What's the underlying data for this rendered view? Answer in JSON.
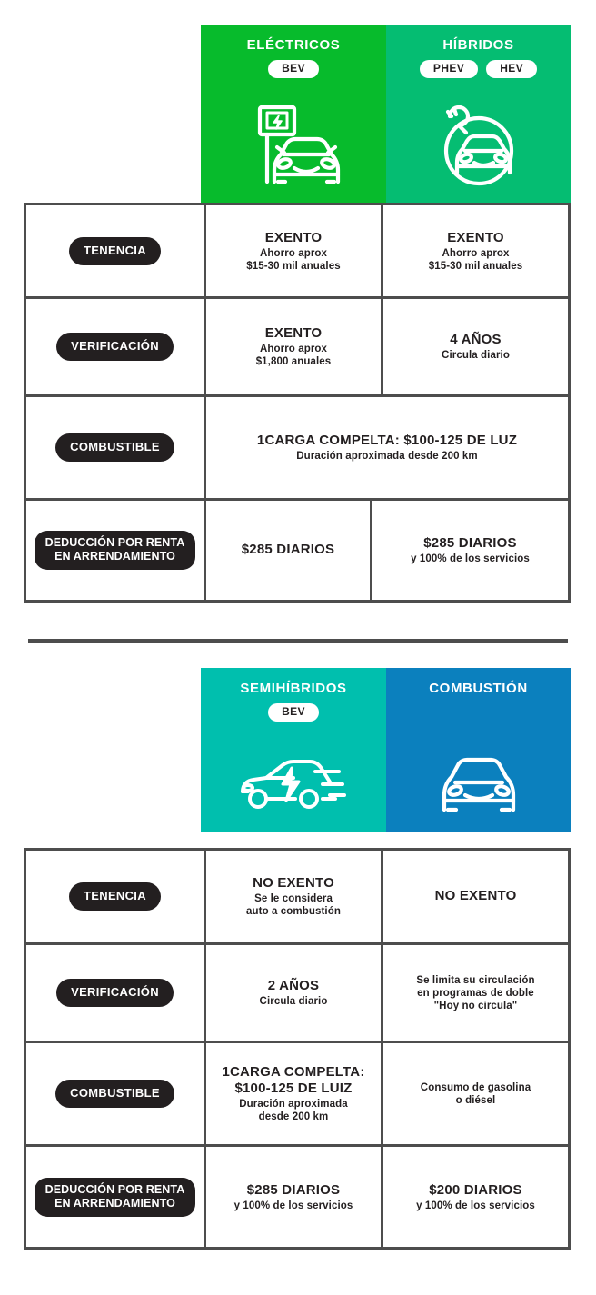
{
  "tables": [
    {
      "id": "electric-hybrid",
      "headers": [
        {
          "title": "ELÉCTRICOS",
          "badges": [
            "BEV"
          ],
          "color": "#07BB2C",
          "icon": "ev-charging-station-car-icon"
        },
        {
          "title": "HÍBRIDOS",
          "badges": [
            "PHEV",
            "HEV"
          ],
          "color": "#05BD72",
          "icon": "plug-in-hybrid-car-circle-icon"
        }
      ],
      "rows": [
        {
          "label": "TENENCIA",
          "cells": [
            {
              "main": "EXENTO",
              "sub": "Ahorro aprox\n$15-30 mil anuales"
            },
            {
              "main": "EXENTO",
              "sub": "Ahorro aprox\n$15-30 mil anuales"
            }
          ]
        },
        {
          "label": "VERIFICACIÓN",
          "cells": [
            {
              "main": "EXENTO",
              "sub": "Ahorro aprox\n$1,800 anuales"
            },
            {
              "main": "4 AÑOS",
              "sub": "Circula diario"
            }
          ]
        },
        {
          "label": "COMBUSTIBLE",
          "merged": true,
          "cells": [
            {
              "main": "1CARGA COMPELTA: $100-125 DE LUZ",
              "sub": "Duración aproximada desde 200 km"
            }
          ]
        },
        {
          "label": "DEDUCCIÓN POR RENTA\nEN ARRENDAMIENTO",
          "twoLine": true,
          "cells": [
            {
              "main": "$285 DIARIOS",
              "sub": ""
            },
            {
              "main": "$285 DIARIOS",
              "sub": "y 100% de los servicios"
            }
          ]
        }
      ]
    },
    {
      "id": "mildhybrid-combustion",
      "headers": [
        {
          "title": "SEMIHÍBRIDOS",
          "badges": [
            "BEV"
          ],
          "color": "#00BFAE",
          "icon": "mild-hybrid-car-bolt-icon"
        },
        {
          "title": "COMBUSTIÓN",
          "badges": [],
          "color": "#0B80BE",
          "icon": "combustion-car-front-icon"
        }
      ],
      "rows": [
        {
          "label": "TENENCIA",
          "cells": [
            {
              "main": "NO EXENTO",
              "sub": "Se le considera\nauto a combustión"
            },
            {
              "main": "NO EXENTO",
              "sub": ""
            }
          ]
        },
        {
          "label": "VERIFICACIÓN",
          "cells": [
            {
              "main": "2 AÑOS",
              "sub": "Circula diario"
            },
            {
              "main": "",
              "sub": "Se limita su circulación\nen programas de doble\n\"Hoy no circula\""
            }
          ]
        },
        {
          "label": "COMBUSTIBLE",
          "cells": [
            {
              "main": "1CARGA COMPELTA:\n$100-125 DE LUIZ",
              "sub": "Duración aproximada\ndesde 200 km"
            },
            {
              "main": "",
              "sub": "Consumo de gasolina\no diésel"
            }
          ]
        },
        {
          "label": "DEDUCCIÓN POR RENTA\nEN ARRENDAMIENTO",
          "twoLine": true,
          "cells": [
            {
              "main": "$285 DIARIOS",
              "sub": "y 100% de los servicios"
            },
            {
              "main": "$200 DIARIOS",
              "sub": "y 100% de los servicios"
            }
          ]
        }
      ]
    }
  ],
  "colors": {
    "border": "#4D4D4D",
    "pill": "#231F20",
    "text": "#231F20",
    "white": "#FFFFFF"
  },
  "separator": {
    "name": "section-separator"
  }
}
